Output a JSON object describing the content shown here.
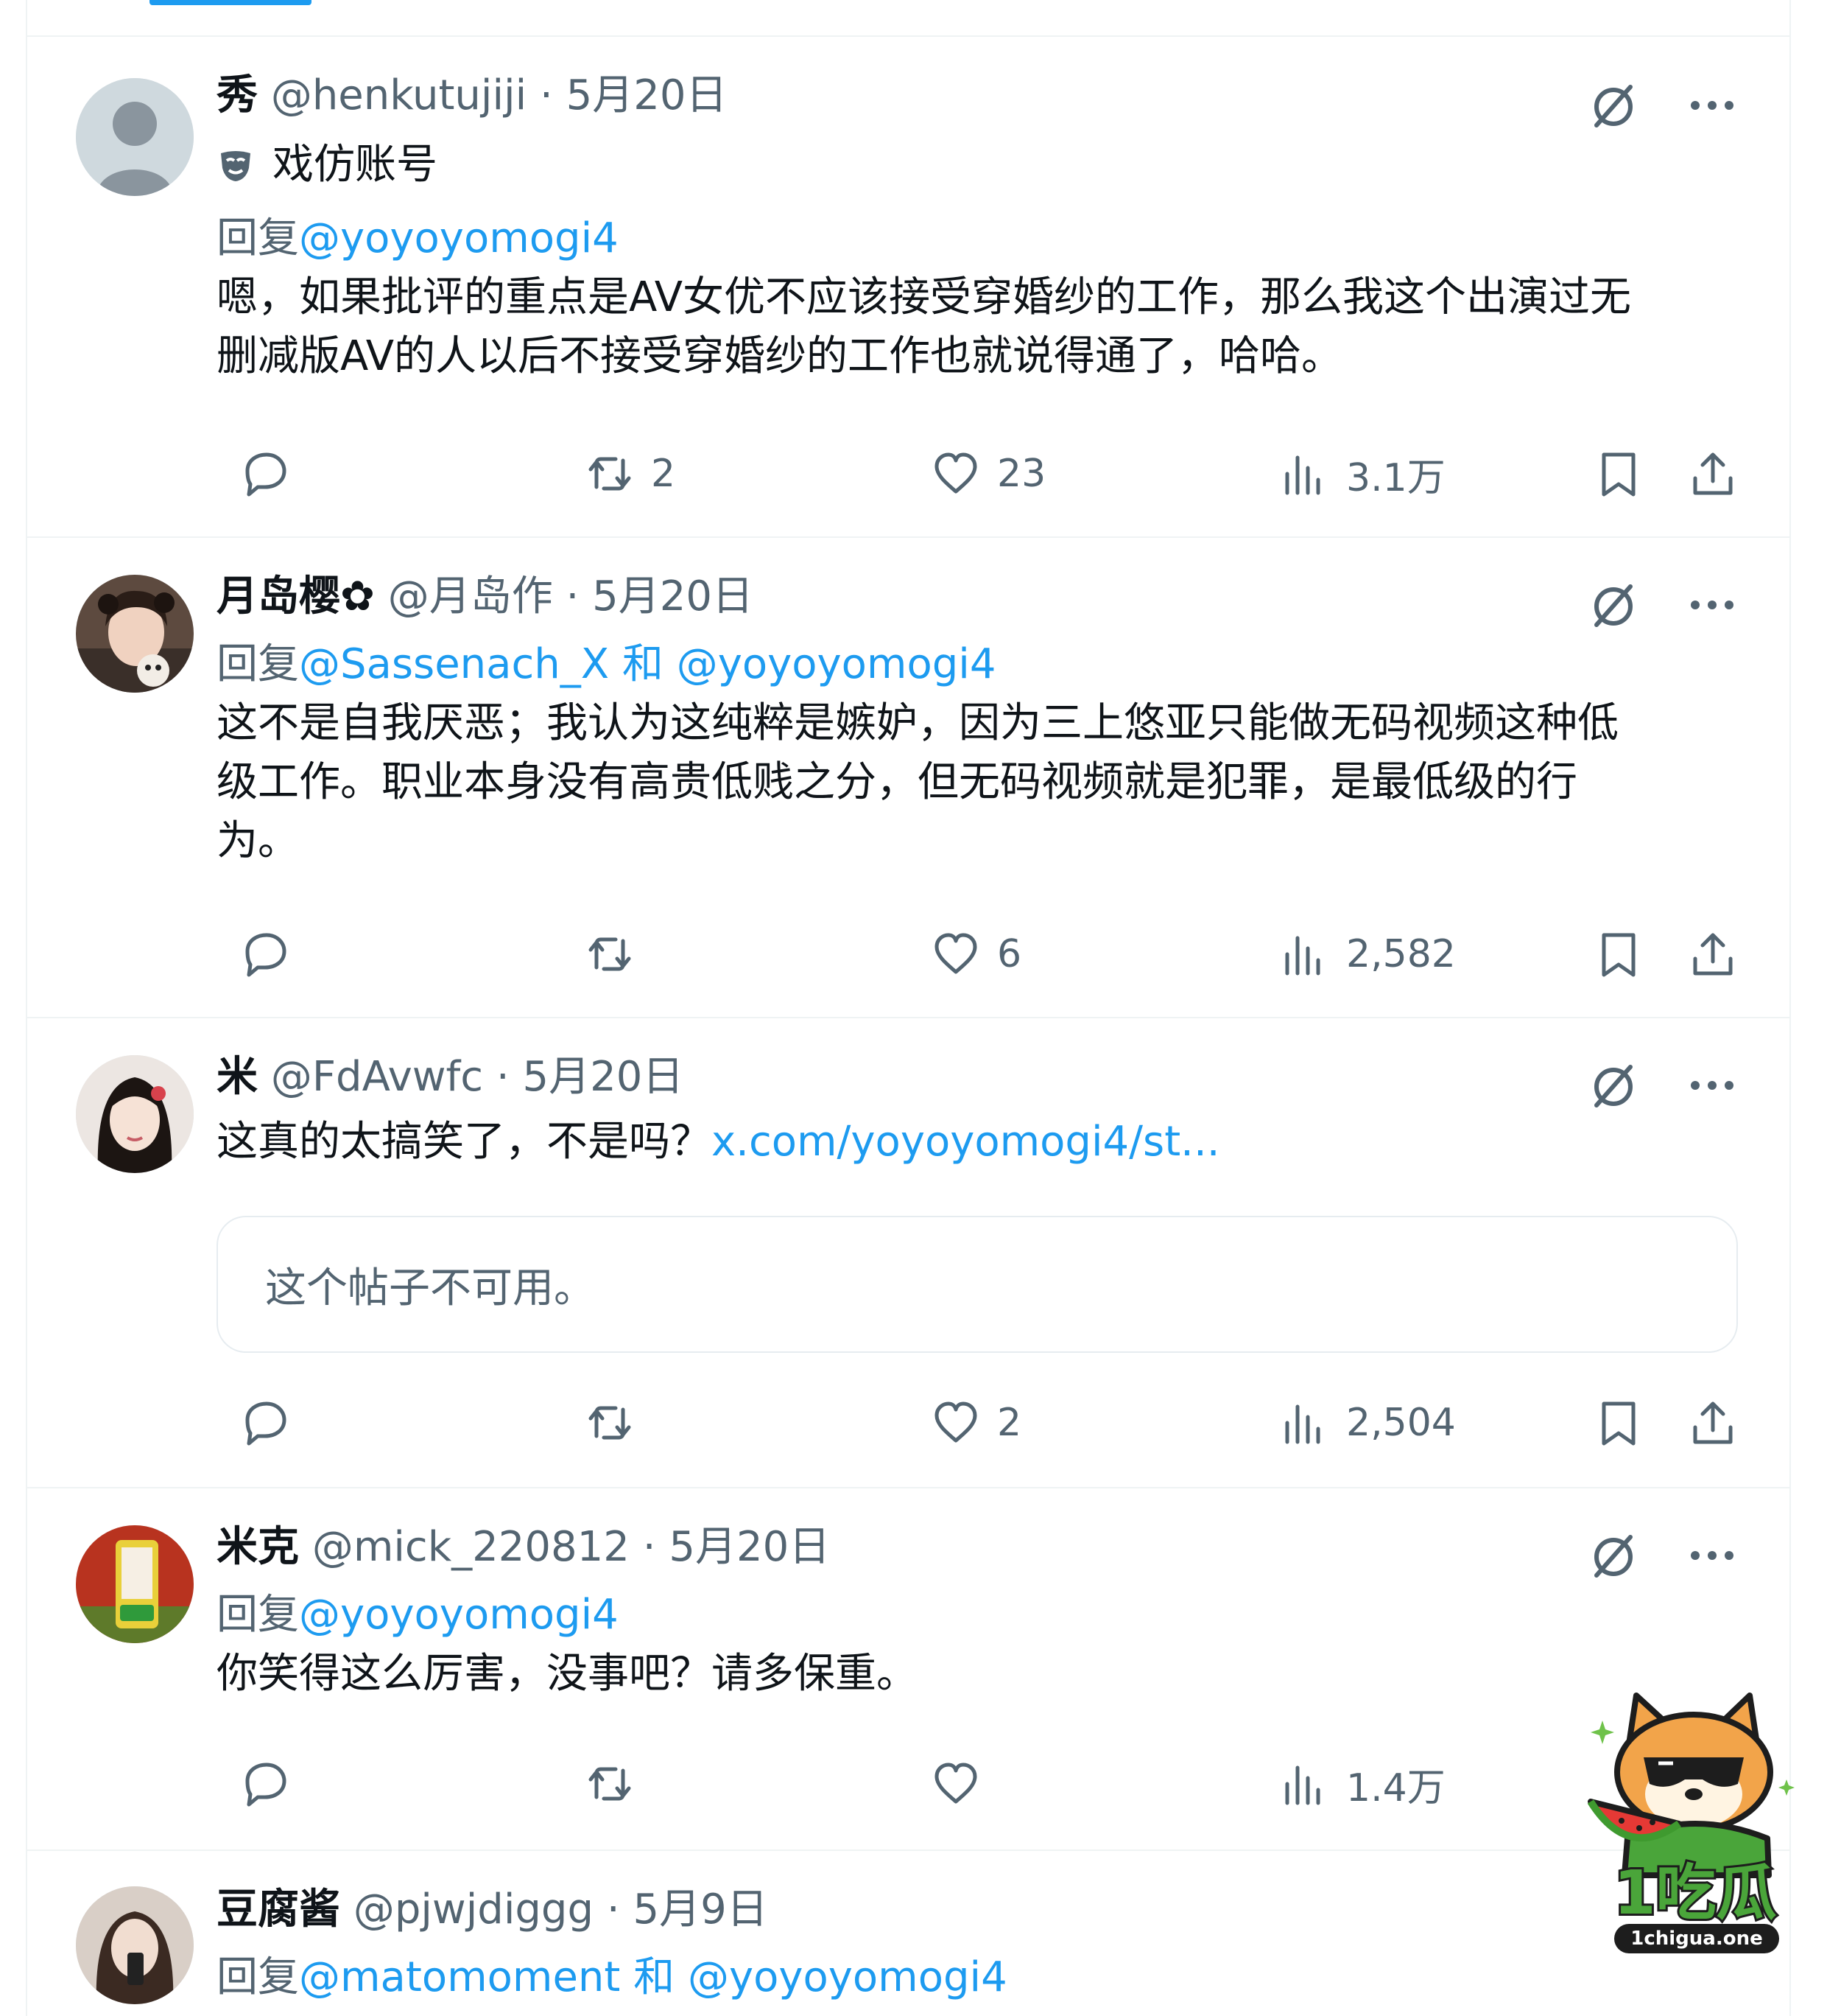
{
  "tweets": [
    {
      "name": "秀",
      "handle": "@henkutujiji",
      "date": "5月20日",
      "label": "戏仿账号",
      "reply_prefix": "回复",
      "reply_to": "@yoyoyomogi4",
      "text_line1": "嗯，如果批评的重点是AV女优不应该接受穿婚纱的工作，那么我这个出演过无",
      "text_line2": "删减版AV的人以后不接受穿婚纱的工作也就说得通了，哈哈。",
      "replies": "",
      "retweets": "2",
      "likes": "23",
      "views": "3.1万"
    },
    {
      "name": "月岛樱✿",
      "handle": "@月岛作",
      "date": "5月20日",
      "reply_prefix": "回复",
      "reply_to": "@Sassenach_X 和 @yoyoyomogi4",
      "text_line1": "这不是自我厌恶；我认为这纯粹是嫉妒，因为三上悠亚只能做无码视频这种低",
      "text_line2": "级工作。职业本身没有高贵低贱之分，但无码视频就是犯罪，是最低级的行",
      "text_line3": "为。",
      "replies": "",
      "retweets": "",
      "likes": "6",
      "views": "2,582"
    },
    {
      "name": "米",
      "handle": "@FdAvwfc",
      "date": "5月20日",
      "text_line1": "这真的太搞笑了，不是吗？",
      "link": "x.com/yoyoyomogi4/st...",
      "quote_unavailable": "这个帖子不可用。",
      "replies": "",
      "retweets": "",
      "likes": "2",
      "views": "2,504"
    },
    {
      "name": "米克",
      "handle": "@mick_220812",
      "date": "5月20日",
      "reply_prefix": "回复",
      "reply_to": "@yoyoyomogi4",
      "text_line1": "你笑得这么厉害，没事吧？请多保重。",
      "replies": "",
      "retweets": "",
      "likes": "",
      "views": "1.4万"
    },
    {
      "name": "豆腐酱",
      "handle": "@pjwjdiggg",
      "date": "5月9日",
      "reply_prefix": "回复",
      "reply_to": "@matomoment 和 @yoyoyomogi4"
    }
  ],
  "watermark": {
    "brand": "1吃瓜",
    "site": "1chigua.one"
  },
  "colors": {
    "accent": "#1d9bf0",
    "secondary_text": "#536471",
    "border": "#eff3f4"
  }
}
